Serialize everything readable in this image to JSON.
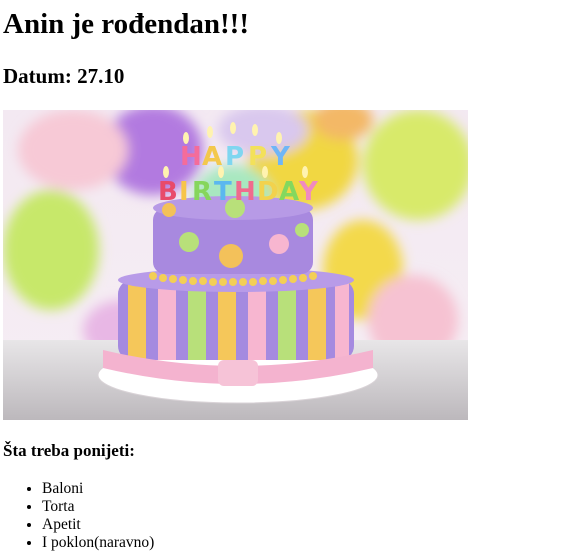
{
  "title": "Anin je rođendan!!!",
  "date_heading": "Datum: 27.10",
  "image": {
    "subject": "birthday-cake-photo",
    "candle_letters": [
      "H",
      "A",
      "P",
      "P",
      "Y",
      "B",
      "I",
      "R",
      "T",
      "H",
      "D",
      "A",
      "Y"
    ]
  },
  "list_heading": "Šta treba ponijeti:",
  "items": [
    "Baloni",
    "Torta",
    "Apetit",
    "I poklon(naravno)"
  ]
}
